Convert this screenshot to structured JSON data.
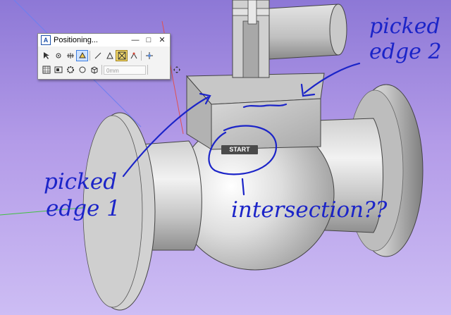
{
  "dialog": {
    "title": "Positioning...",
    "minimize_glyph": "—",
    "maximize_glyph": "□",
    "close_glyph": "✕",
    "row1_icons": [
      "select-arrow-icon",
      "point-snap-icon",
      "mid-snap-icon",
      "face-snap-icon",
      "line-icon",
      "triangle-icon",
      "intersection-snap-icon",
      "vertex-snap-icon",
      "move-snap-icon"
    ],
    "row2_icons": [
      "grid-icon",
      "box-icon",
      "gear-icon",
      "circle-icon",
      "cube-icon",
      "move-icon"
    ],
    "distance_value": "0mm"
  },
  "viewport": {
    "start_label": "START",
    "background_top": "#8d78d6",
    "background_bottom": "#cdbdf4"
  },
  "annotations": {
    "picked_edge_2_line1": "picked",
    "picked_edge_2_line2": "edge 2",
    "picked_edge_1_line1": "picked",
    "picked_edge_1_line2": "edge 1",
    "intersection": "intersection??",
    "ink_color": "#1b24c8"
  }
}
